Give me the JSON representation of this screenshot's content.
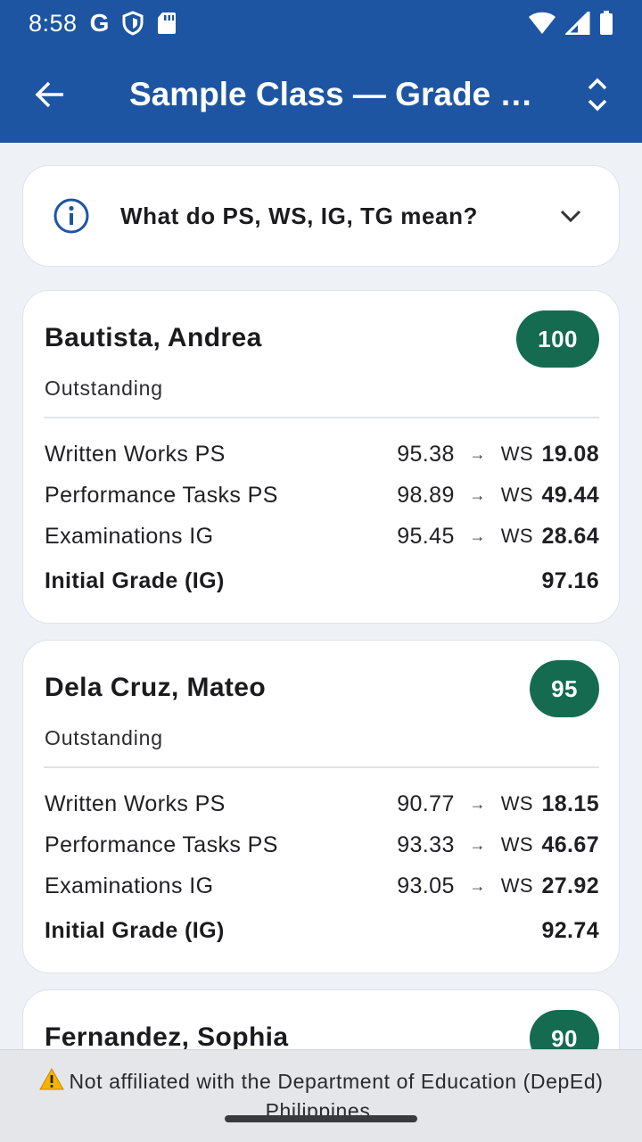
{
  "status_bar": {
    "time": "8:58",
    "g": "G"
  },
  "app_bar": {
    "title": "Sample Class — Grade …"
  },
  "info": {
    "text": "What do PS, WS, IG, TG mean?"
  },
  "labels": {
    "ws": "WS",
    "initial_grade": "Initial Grade (IG)",
    "arrow": "→"
  },
  "students": [
    {
      "name": "Bautista, Andrea",
      "grade": "100",
      "descriptor": "Outstanding",
      "rows": [
        {
          "label": "Written Works PS",
          "ps": "95.38",
          "ws": "19.08"
        },
        {
          "label": "Performance Tasks PS",
          "ps": "98.89",
          "ws": "49.44"
        },
        {
          "label": "Examinations IG",
          "ps": "95.45",
          "ws": "28.64"
        }
      ],
      "initial_grade": "97.16"
    },
    {
      "name": "Dela Cruz, Mateo",
      "grade": "95",
      "descriptor": "Outstanding",
      "rows": [
        {
          "label": "Written Works PS",
          "ps": "90.77",
          "ws": "18.15"
        },
        {
          "label": "Performance Tasks PS",
          "ps": "93.33",
          "ws": "46.67"
        },
        {
          "label": "Examinations IG",
          "ps": "93.05",
          "ws": "27.92"
        }
      ],
      "initial_grade": "92.74"
    },
    {
      "name": "Fernandez, Sophia",
      "grade": "90"
    }
  ],
  "footer": {
    "notice": "Not affiliated with the Department of Education (DepEd) Philippines."
  },
  "colors": {
    "primary": "#1d55a3",
    "badge": "#146b4f",
    "background": "#eef1f5",
    "card": "#ffffff"
  },
  "icons": {
    "back": "arrow-back-icon",
    "sort": "unfold-icon",
    "info": "info-icon",
    "expand": "chevron-down-icon",
    "warning": "warning-icon"
  }
}
